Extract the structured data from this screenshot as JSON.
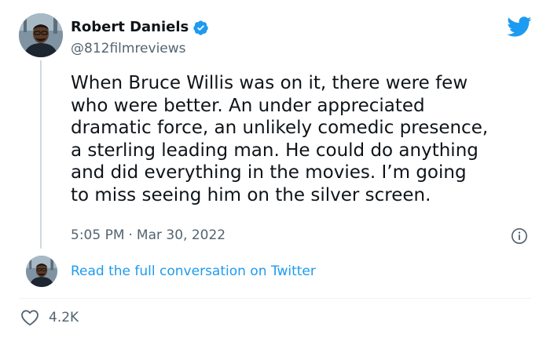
{
  "tweet": {
    "author": {
      "display_name": "Robert Daniels",
      "handle": "@812filmreviews",
      "verified": true
    },
    "text": "When Bruce Willis was on it, there were few\nwho were better. An under appreciated\ndramatic force, an unlikely comedic presence,\na sterling leading man. He could do anything\nand did everything in the movies. I’m going\nto miss seeing him on the silver screen.",
    "time": "5:05 PM",
    "separator": "·",
    "date": "Mar 30, 2022",
    "read_more_label": "Read the full conversation on Twitter",
    "like_count": "4.2K"
  },
  "icons": {
    "brand": "twitter-bird-icon",
    "verified": "verified-badge-icon",
    "info": "info-icon",
    "like": "heart-icon"
  },
  "colors": {
    "accent": "#1d9bf0",
    "text_primary": "#0f1419",
    "text_secondary": "#536471",
    "divider": "#eff3f4"
  }
}
